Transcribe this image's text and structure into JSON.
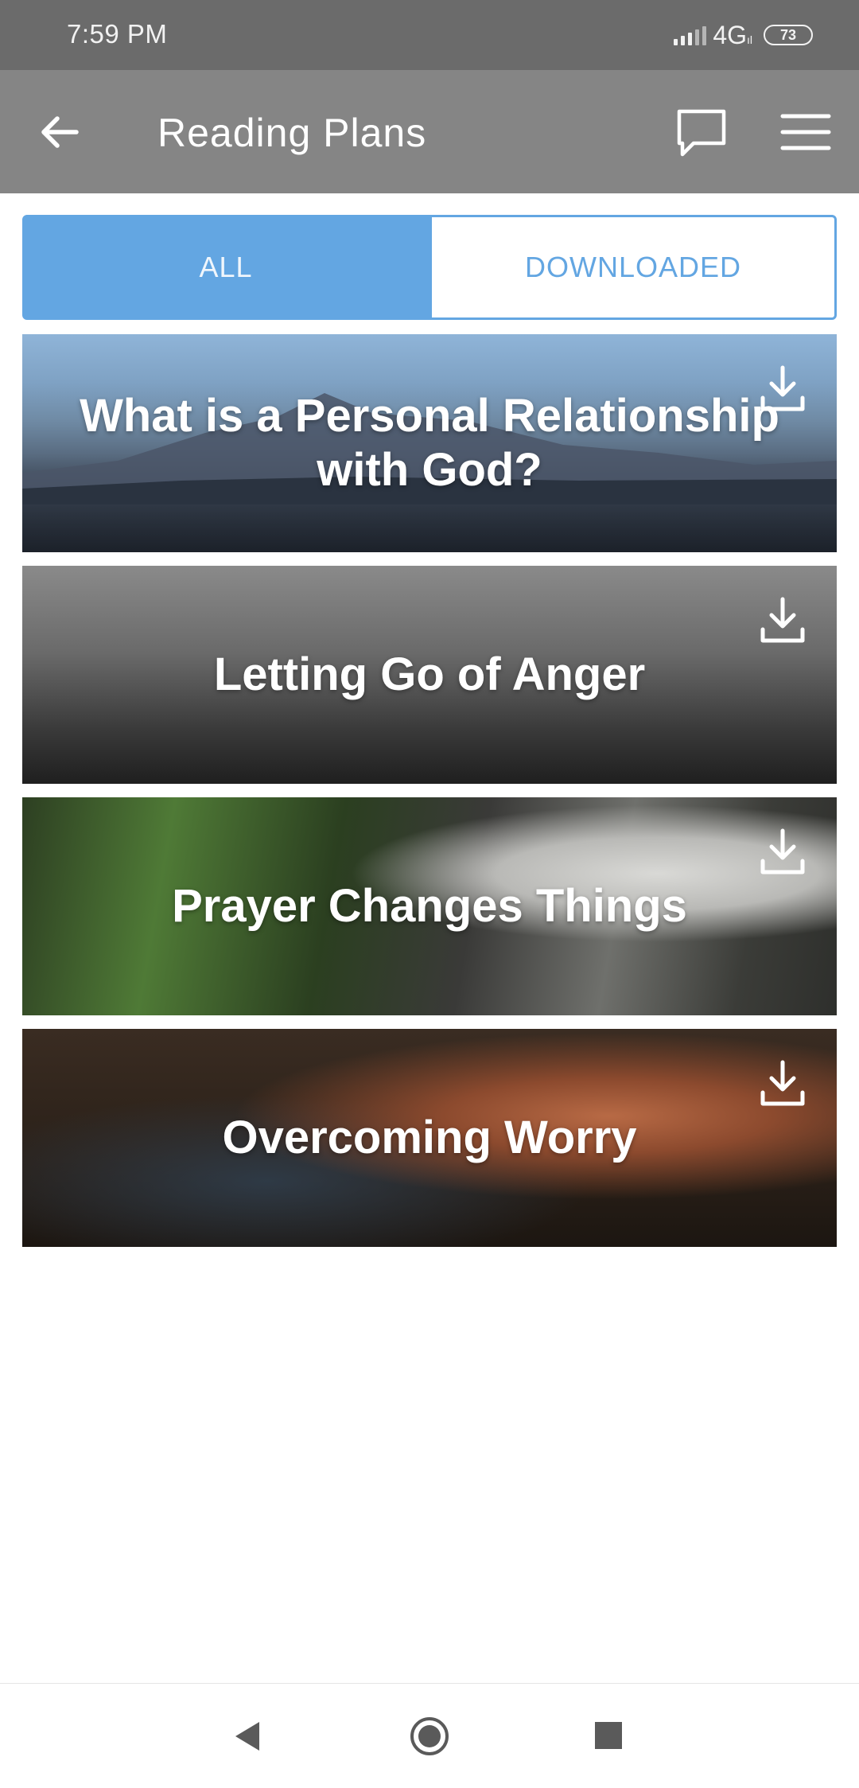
{
  "status_bar": {
    "time": "7:59 PM",
    "network": "4G",
    "battery": "73"
  },
  "app_bar": {
    "title": "Reading Plans",
    "icons": [
      "arrow-left-icon",
      "chat-icon",
      "menu-icon"
    ]
  },
  "tabs": [
    {
      "label": "ALL",
      "selected": true
    },
    {
      "label": "DOWNLOADED",
      "selected": false
    }
  ],
  "plans": [
    {
      "title": "What is a Personal Relationship with God?"
    },
    {
      "title": "Letting Go of Anger"
    },
    {
      "title": "Prayer Changes Things"
    },
    {
      "title": "Overcoming Worry"
    }
  ],
  "colors": {
    "accent": "#63a6e2",
    "app_bar": "#858585",
    "status_bar": "#6b6b6b"
  }
}
